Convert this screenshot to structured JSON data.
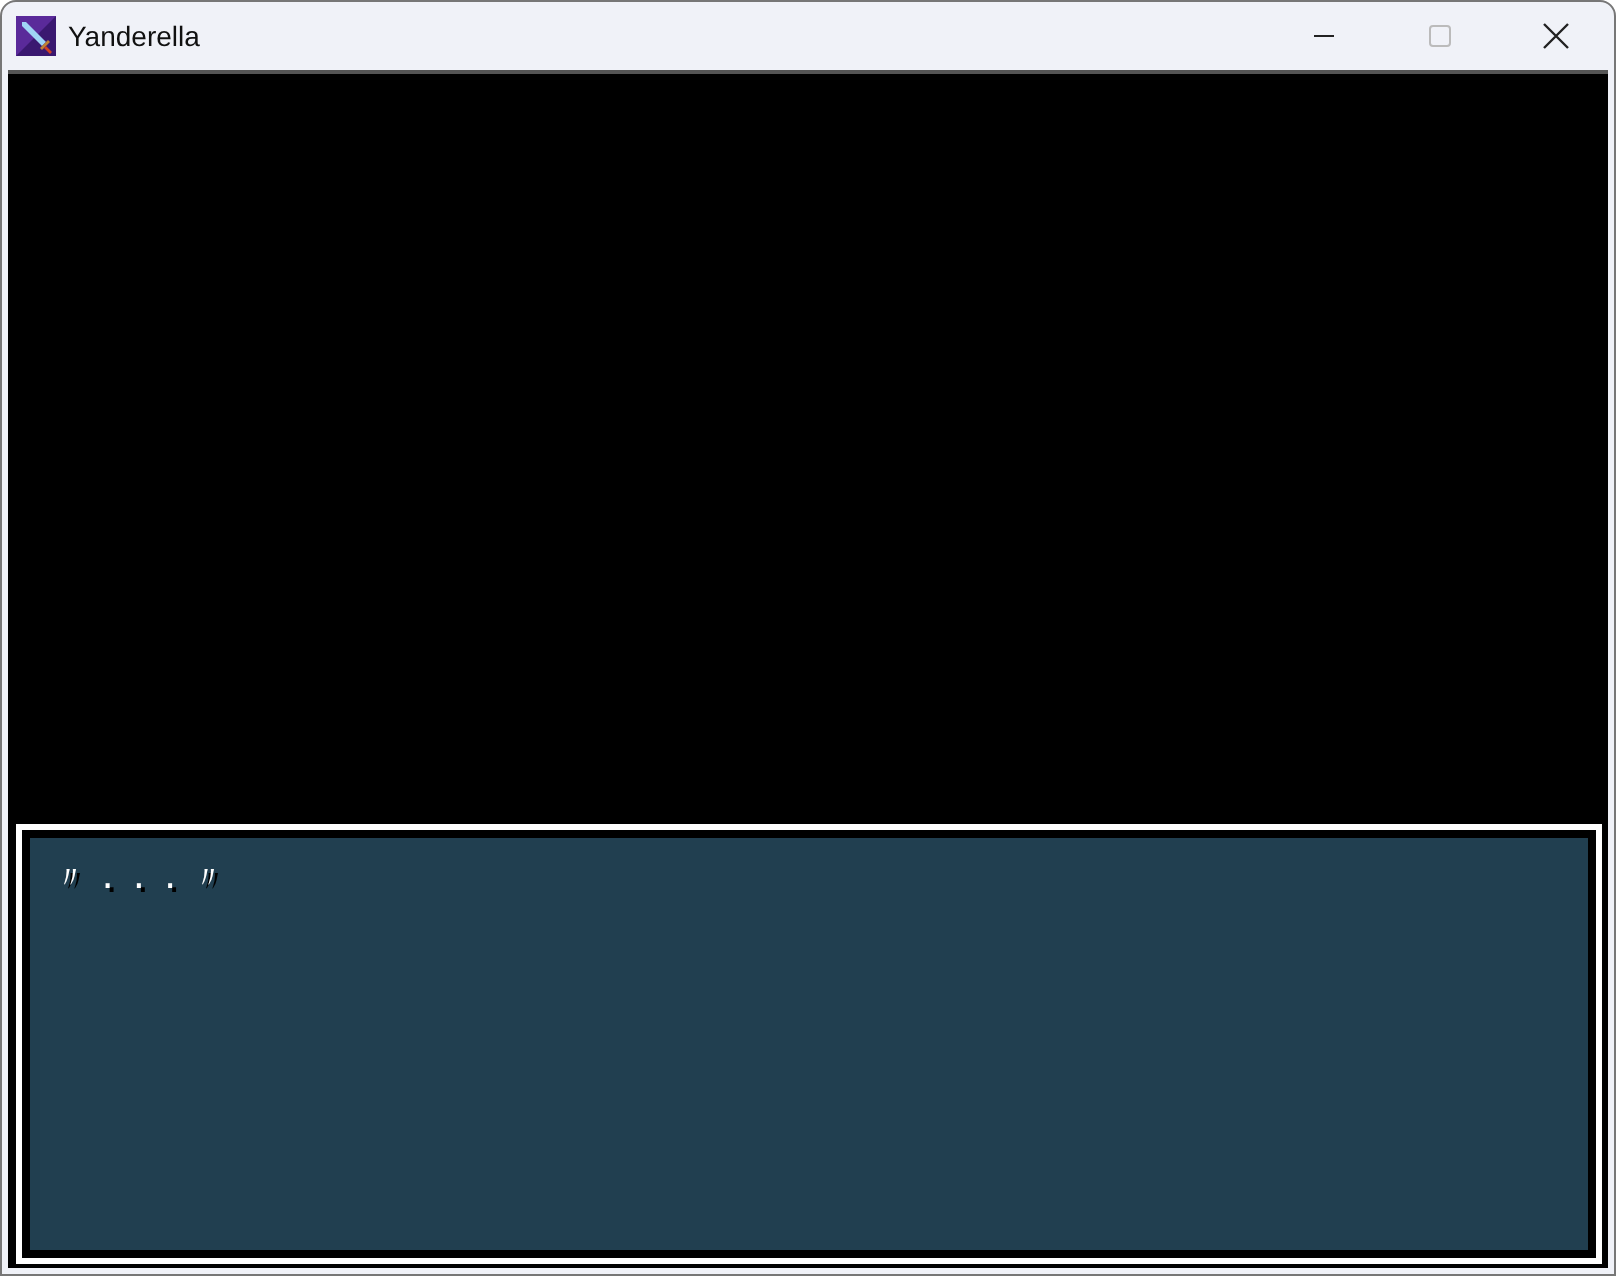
{
  "window": {
    "title": "Yanderella",
    "maximize_disabled": true
  },
  "message_box": {
    "text": "〃...〃"
  }
}
